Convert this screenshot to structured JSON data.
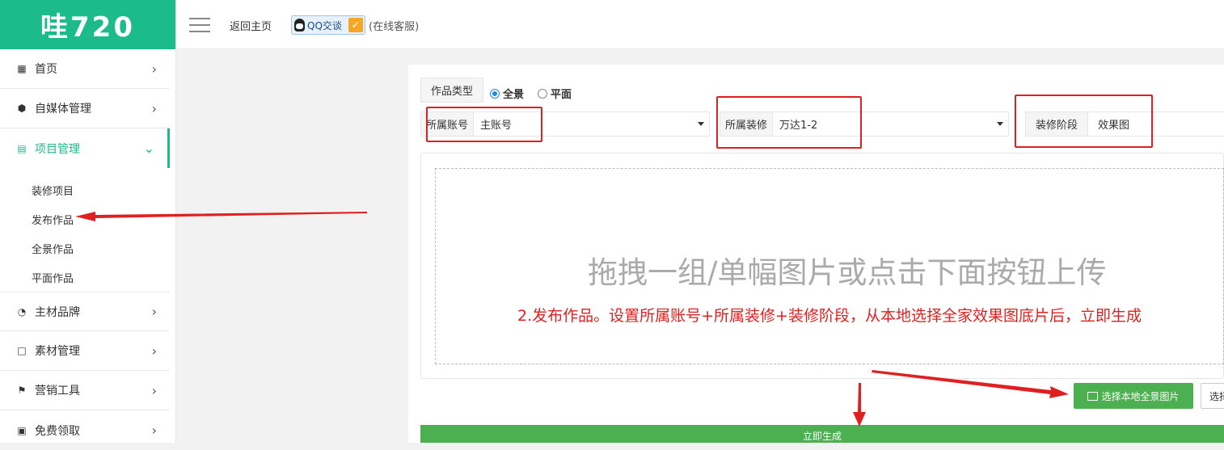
{
  "logo": "哇720",
  "topbar": {
    "home_label": "返回主页",
    "qq_label": "QQ交谈",
    "online_label": "(在线客服)"
  },
  "sidebar": {
    "items": [
      {
        "label": "首页",
        "icon": "grid-icon"
      },
      {
        "label": "自媒体管理",
        "icon": "cube-icon"
      },
      {
        "label": "项目管理",
        "icon": "bar-chart-icon",
        "active": true
      },
      {
        "label": "主材品牌",
        "icon": "pie-chart-icon"
      },
      {
        "label": "素材管理",
        "icon": "file-icon"
      },
      {
        "label": "营销工具",
        "icon": "flag-icon"
      },
      {
        "label": "免费领取",
        "icon": "cart-icon"
      }
    ],
    "subitems": [
      "装修项目",
      "发布作品",
      "全景作品",
      "平面作品"
    ]
  },
  "form": {
    "type_label": "作品类型",
    "radio_options": [
      "全景",
      "平面"
    ],
    "account": {
      "label": "所属账号",
      "value": "主账号"
    },
    "decoration": {
      "label": "所属装修",
      "value": "万达1-2"
    },
    "stage": {
      "label": "装修阶段",
      "value": "效果图"
    }
  },
  "dropzone": {
    "text": "拖拽一组/单幅图片或点击下面按钮上传"
  },
  "annotation": "2.发布作品。设置所属账号+所属装修+装修阶段，从本地选择全家效果图底片后，立即生成",
  "buttons": {
    "select_local": "选择本地全景图片",
    "select_other": "选择",
    "generate": "立即生成"
  },
  "colors": {
    "brand": "#1cbb8c",
    "button": "#4caf50",
    "annotation": "#e02020"
  }
}
